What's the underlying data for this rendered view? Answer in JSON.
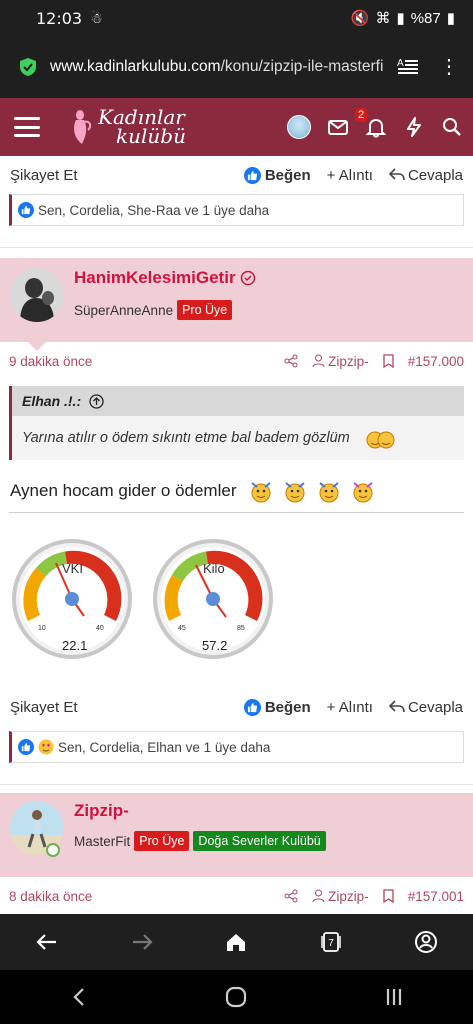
{
  "status_bar": {
    "time": "12:03",
    "battery": "%87"
  },
  "browser": {
    "url_domain": "www.kadinlarkulubu.com",
    "url_path": "/konu/zipzip-ile-masterfi",
    "tab_count": "7"
  },
  "site": {
    "logo_line1": "Kadınlar",
    "logo_line2": "kulübü",
    "notification_count": "2"
  },
  "post_prev": {
    "report": "Şikayet Et",
    "like": "Beğen",
    "quote": "+ Alıntı",
    "reply": "Cevapla",
    "reactions": "Sen, Cordelia, She-Raa ve 1 üye daha"
  },
  "post": {
    "username": "HanimKelesimiGetir",
    "user_title": "SüperAnneAnne",
    "badge": "Pro Üye",
    "time_ago": "9 dakika önce",
    "thread_tag": "Zipzip-",
    "post_number": "#157.000",
    "quote_author": "Elhan .!.:",
    "quote_text": "Yarına atılır o ödem sıkıntı etme bal badem gözlüm",
    "body": "Aynen hocam gider o ödemler",
    "gauge1": {
      "label": "VKI",
      "min": "10",
      "max": "40",
      "value": "22.1"
    },
    "gauge2": {
      "label": "Kilo",
      "min": "45",
      "max": "85",
      "value": "57.2"
    },
    "report": "Şikayet Et",
    "like": "Beğen",
    "quote": "+ Alıntı",
    "reply": "Cevapla",
    "reactions": "Sen, Cordelia, Elhan ve 1 üye daha"
  },
  "post_next": {
    "username": "Zipzip-",
    "user_title": "MasterFit",
    "badge": "Pro Üye",
    "club_badge": "Doğa Severler Kulübü",
    "time_ago": "8 dakika önce",
    "thread_tag": "Zipzip-",
    "post_number": "#157.001"
  },
  "colors": {
    "brand": "#8b2a3f",
    "post_header_bg": "#f0ced6",
    "username": "#d1123f",
    "badge_red": "#d81b1b",
    "badge_green": "#148a1d"
  }
}
